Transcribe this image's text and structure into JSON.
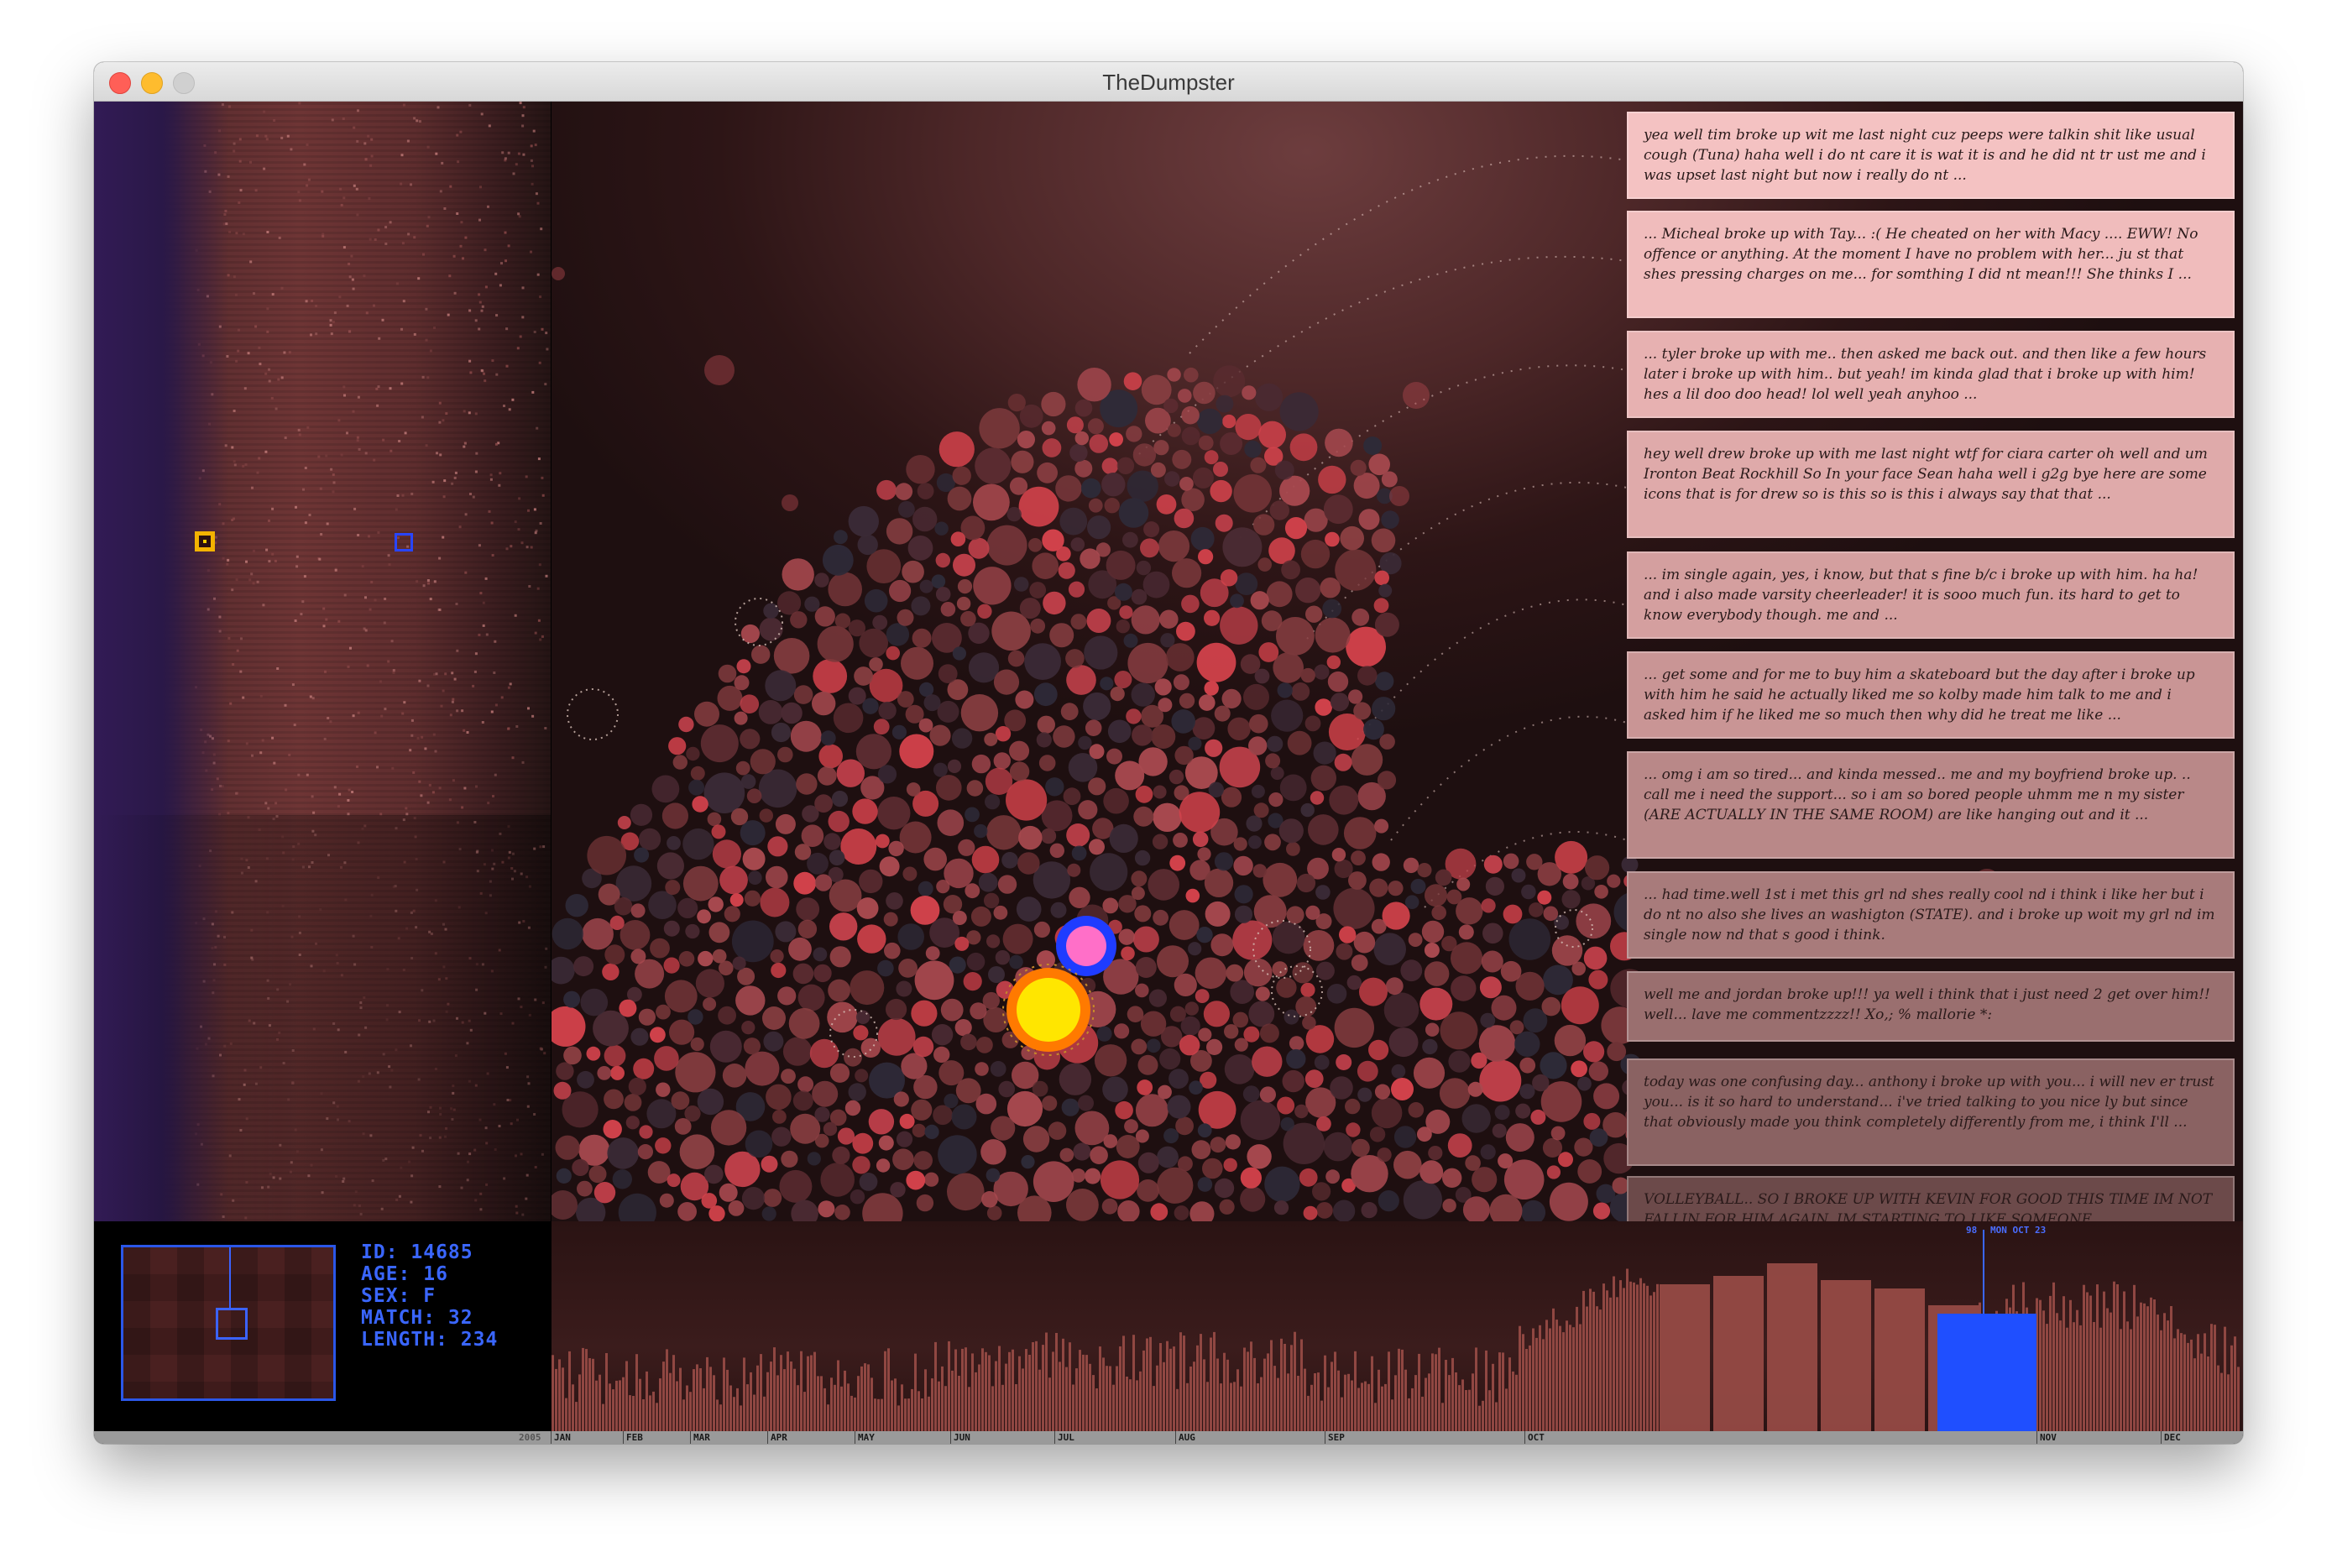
{
  "window": {
    "title": "TheDumpster"
  },
  "stats": {
    "id": "ID: 14685",
    "age": "AGE: 16",
    "sex": "SEX: F",
    "match": "MATCH: 32",
    "length": "LENGTH: 234"
  },
  "selection": {
    "count": "98",
    "date": "MON OCT 23"
  },
  "timeline": {
    "year": "2005",
    "months": [
      "JAN",
      "FEB",
      "MAR",
      "APR",
      "MAY",
      "JUN",
      "JUL",
      "AUG",
      "SEP",
      "OCT",
      "NOV",
      "DEC"
    ]
  },
  "messages": [
    {
      "text": "yea well tim broke up wit me last night cuz peeps were talkin shit like usual cough (Tuna) haha well i do nt care it is wat it is and he did nt tr ust me and i was upset last night but now i really do nt ...",
      "color": "#f4c2c2"
    },
    {
      "text": "... Micheal broke up with Tay... :( He cheated on her with Macy .... EWW! No offence or anything. At the moment I have no problem with her... ju st that shes pressing charges on me... for somthing I did nt mean!!! She thinks I ...",
      "color": "#f0bcbc"
    },
    {
      "text": "... tyler broke up with me.. then asked me back out. and then like a few hours later i broke up with him.. but yeah! im kinda glad that i broke up with him! hes a lil doo doo head! lol well yeah anyhoo ...",
      "color": "#e7b1b1"
    },
    {
      "text": "hey well drew broke up with me last night wtf for ciara carter oh well and um Ironton Beat Rockhill So In your face Sean haha well i g2g bye here are some icons that is for drew so is this so is this i always say that that ...",
      "color": "#dfaaaa"
    },
    {
      "text": "... im single again, yes, i know, but that s fine b/c i broke up with him. ha ha! and i also made varsity cheerleader! it is sooo much fun. its hard to get to know everybody though. me and ...",
      "color": "#d49f9f"
    },
    {
      "text": "... get some and for me to buy him a skateboard but the day after i broke up with him he said he actually liked me so kolby made him talk to me and i asked him if he liked me so much then why did he treat me like ...",
      "color": "#c99595"
    },
    {
      "text": "... omg i am so tired... and kinda messed.. me and my boyfriend broke up. .. call me i need the support... so i am so bored people uhmm me n my sister (ARE ACTUALLY IN THE SAME ROOM) are like hanging out and it ...",
      "color": "#b98888"
    },
    {
      "text": "... had time.well 1st i met this grl nd shes really cool nd i think i like her but i do nt no also she lives an washigton (STATE). and i broke up woit my grl nd im single now nd that s good i think.",
      "color": "#a87b7b"
    },
    {
      "text": "well me and jordan broke up!!! ya well i think that i just need 2 get over him!! well... lave me commentzzzz!! Xo,; % mallorie *:",
      "color": "#9a6f6f"
    },
    {
      "text": "today was one confusing day... anthony i broke up with you... i will nev er trust you... is it so hard to understand... i've tried talking to you nice ly but since that obviously made you think completely differently from me, i think I'll ...",
      "color": "#8a6262"
    },
    {
      "text": "VOLLEYBALL.. SO I BROKE UP WITH KEVIN FOR GOOD THIS TIME IM NOT FALLIN FOR HIM AGAIN. IM STARTING TO LIKE SOMEONE",
      "color": "#6c4a4a"
    }
  ],
  "colors": {
    "selected_bubble": "#ffe600",
    "selected_ring": "#ff7a00",
    "match_bubble": "#ff6fc8",
    "match_ring": "#1f3cff",
    "accent_blue": "#3a66ff",
    "bar": "#9a4c47",
    "bar_selected": "#1f4fff"
  },
  "icons": [
    "close-icon",
    "minimize-icon",
    "maximize-icon"
  ]
}
